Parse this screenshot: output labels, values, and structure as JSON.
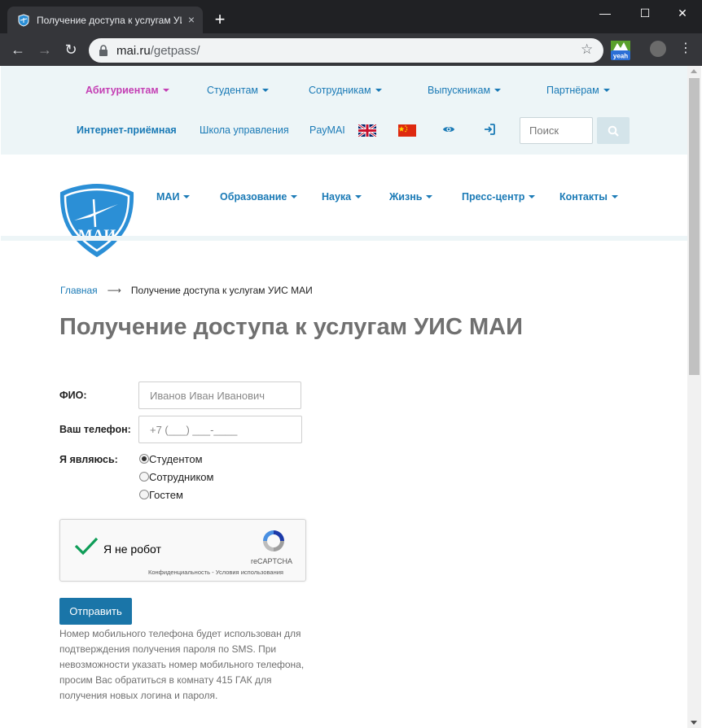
{
  "browser": {
    "tab_title": "Получение доступа к услугам УИС МАИ",
    "tab_close": "×",
    "new_tab": "+",
    "url_host": "mai.ru",
    "url_path": "/getpass/",
    "window_controls": {
      "minimize": "—",
      "maximize": "☐",
      "close": "✕"
    },
    "nav": {
      "back": "←",
      "forward": "→",
      "reload": "↻"
    },
    "star": "☆",
    "menu": "⋮",
    "extension_label": "yeah"
  },
  "topbar": {
    "nav": [
      {
        "label": "Абитуриентам",
        "active": true
      },
      {
        "label": "Студентам",
        "active": false
      },
      {
        "label": "Сотрудникам",
        "active": false
      },
      {
        "label": "Выпускникам",
        "active": false
      },
      {
        "label": "Партнёрам",
        "active": false
      }
    ],
    "links": {
      "admission": "Интернет-приёмная",
      "school": "Школа управления",
      "paymai": "PayMAI"
    },
    "search_placeholder": "Поиск"
  },
  "main_nav": [
    {
      "label": "МАИ"
    },
    {
      "label": "Образование"
    },
    {
      "label": "Наука"
    },
    {
      "label": "Жизнь"
    },
    {
      "label": "Пресс-центр"
    },
    {
      "label": "Контакты"
    }
  ],
  "logo_text": "МАИ",
  "breadcrumb": {
    "home": "Главная",
    "arrow": "⟶",
    "current": "Получение доступа к услугам УИС МАИ"
  },
  "page_title": "Получение доступа к услугам УИС МАИ",
  "form": {
    "fio_label": "ФИО:",
    "fio_placeholder": "Иванов Иван Иванович",
    "phone_label": "Ваш телефон:",
    "phone_placeholder": "+7 (___) ___-____",
    "role_label": "Я являюсь:",
    "roles": [
      {
        "label": "Студентом",
        "checked": true
      },
      {
        "label": "Сотрудником",
        "checked": false
      },
      {
        "label": "Гостем",
        "checked": false
      }
    ],
    "recaptcha": {
      "label": "Я не робот",
      "brand": "reCAPTCHA",
      "links": "Конфиденциальность - Условия использования"
    },
    "submit_label": "Отправить",
    "help_text": "Номер мобильного телефона будет использован для подтверждения получения пароля по SMS. При невозможности указать номер мобильного телефона, просим Вас обратиться в комнату 415 ГАК для получения новых логина и пароля."
  },
  "colors": {
    "link_blue": "#1a7ab6",
    "active_magenta": "#c43fb4",
    "topbar_bg": "#edf5f7",
    "button_blue": "#1a75a8",
    "title_gray": "#707070"
  }
}
